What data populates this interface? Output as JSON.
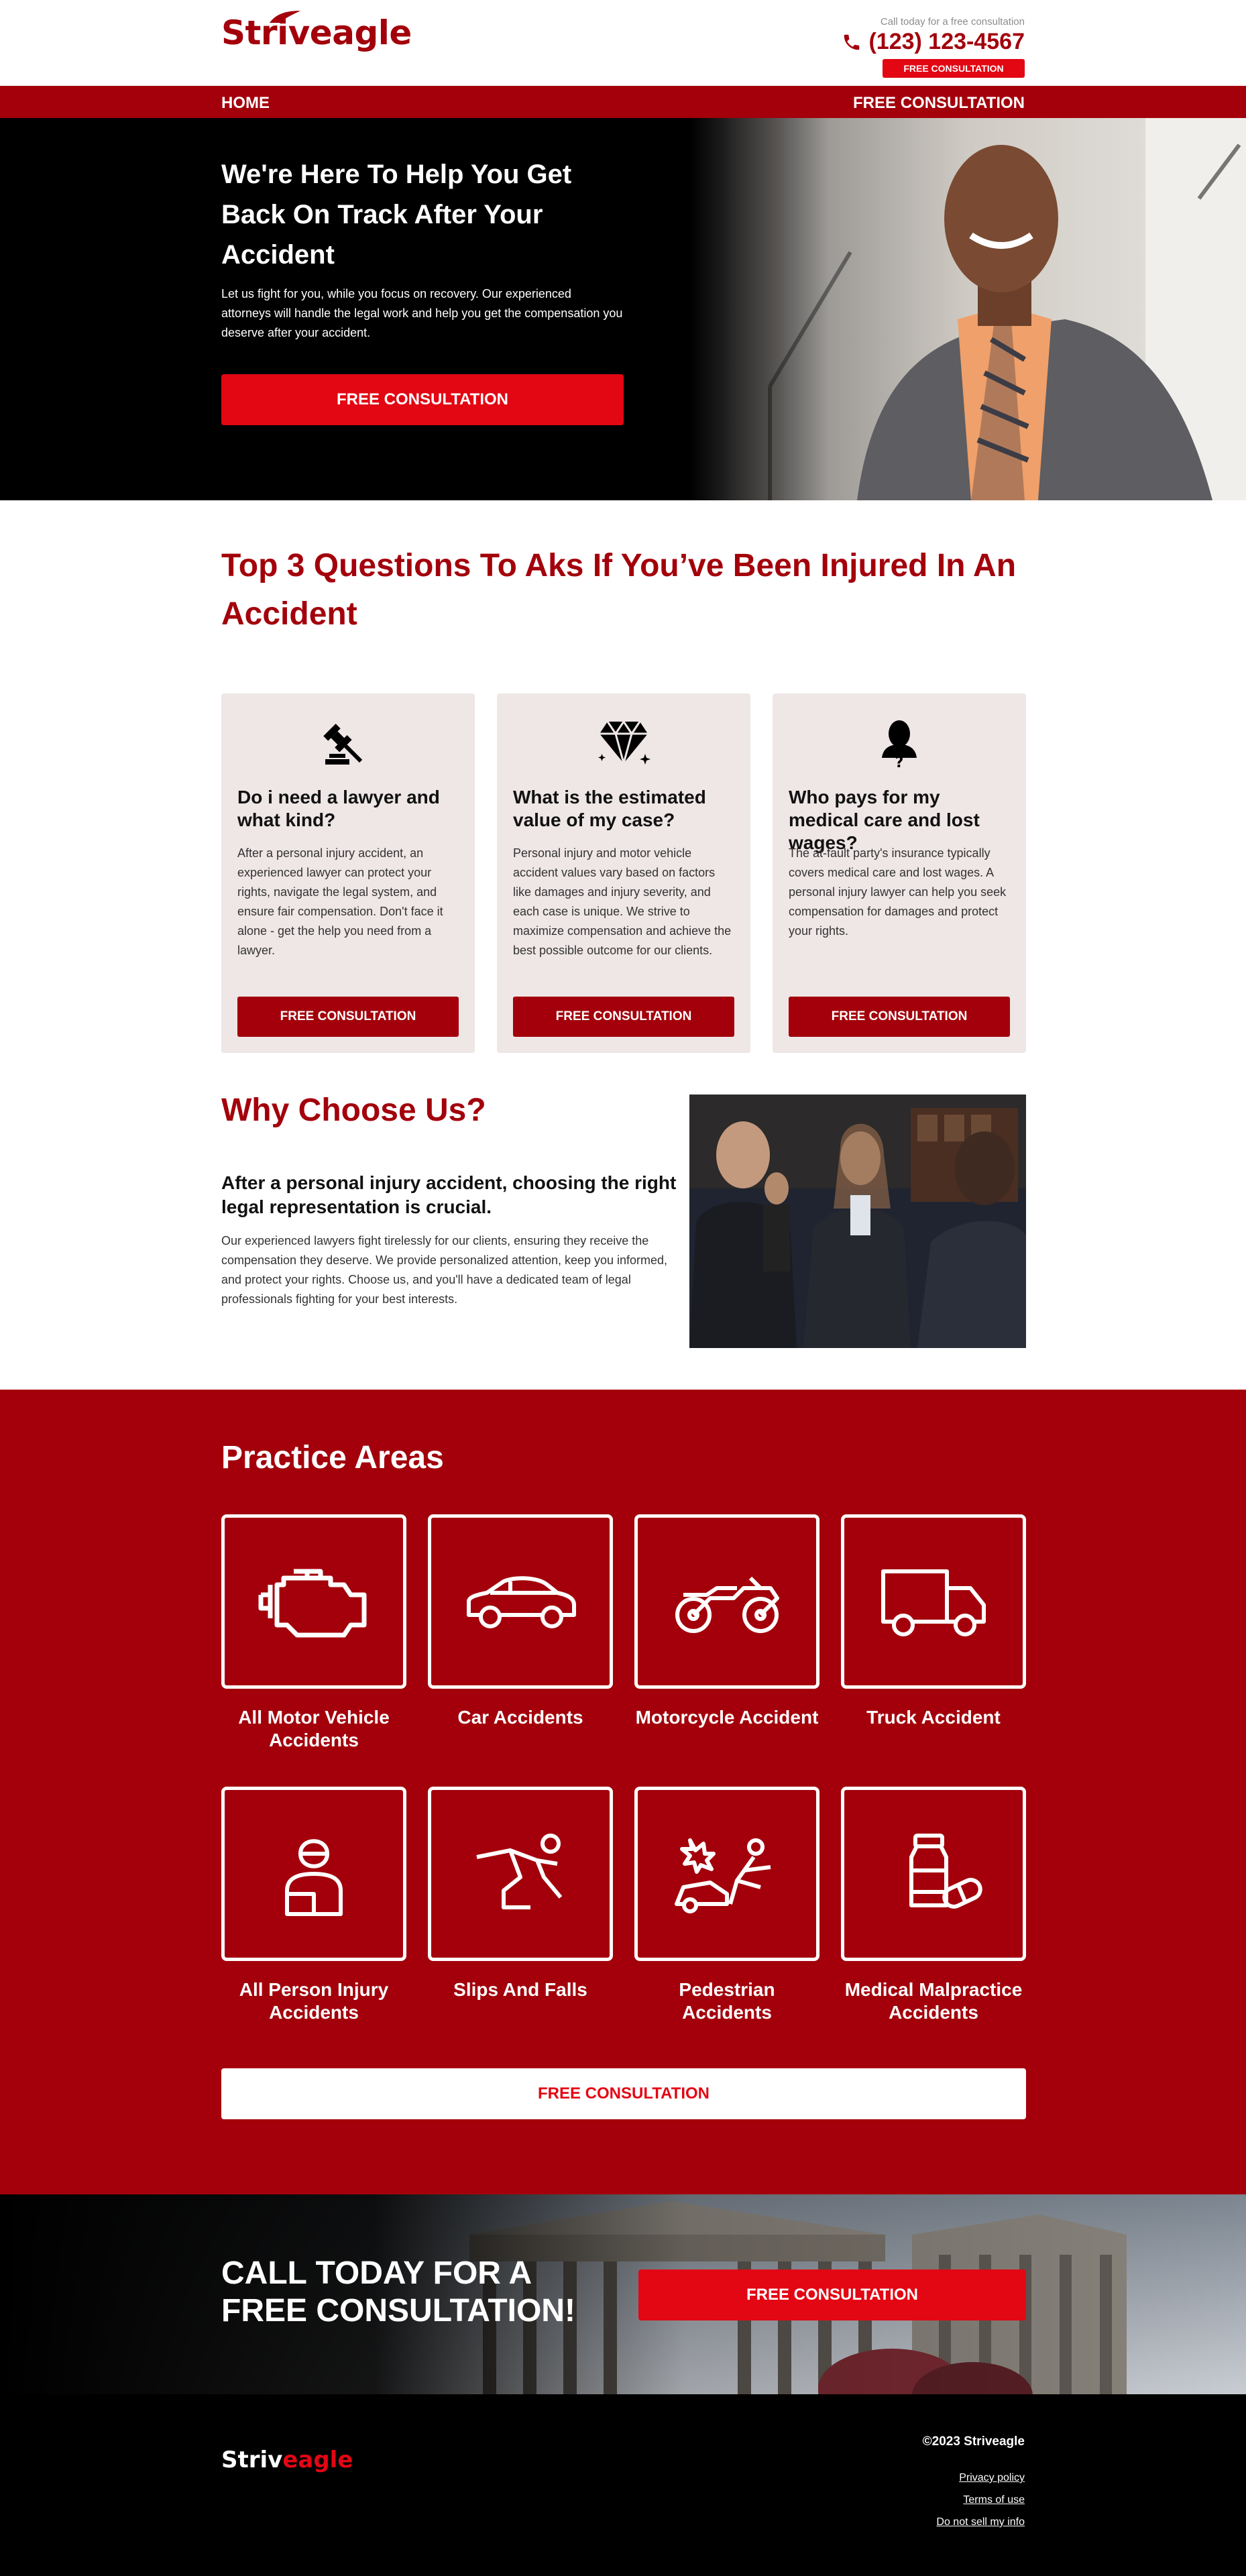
{
  "header": {
    "logo": "Striveagle",
    "consult_note": "Call today for a free consultation",
    "phone": "(123) 123-4567",
    "small_cta": "FREE CONSULTATION"
  },
  "nav": {
    "home": "HOME",
    "free_consultation": "FREE CONSULTATION"
  },
  "hero": {
    "title": "We're Here To Help You Get Back On Track After Your Accident",
    "text": "Let us fight for you, while you focus on recovery. Our experienced attorneys will handle the legal work and help you get the compensation you deserve after your accident.",
    "button": "FREE CONSULTATION"
  },
  "questions": {
    "title": "Top 3 Questions To Aks If You’ve Been Injured In An Accident",
    "cards": [
      {
        "icon": "gavel-icon",
        "heading": "Do i need a lawyer and what kind?",
        "text": "After a personal injury accident, an experienced lawyer can protect your rights, navigate the legal system, and ensure fair compensation. Don't face it alone - get the help you need from a lawyer.",
        "button": "FREE CONSULTATION"
      },
      {
        "icon": "diamond-icon",
        "heading": "What is the estimated value of my case?",
        "text": "Personal injury and motor vehicle accident values vary based on factors like damages and injury severity, and each case is unique. We strive to maximize compensation and achieve the best possible outcome for our clients.",
        "button": "FREE CONSULTATION"
      },
      {
        "icon": "person-question-icon",
        "heading": "Who pays for my medical care and lost wages?",
        "text": "The at-fault party's insurance typically covers medical care and lost wages. A personal injury lawyer can help you seek compensation for damages and protect your rights.",
        "button": "FREE CONSULTATION"
      }
    ]
  },
  "why": {
    "title": "Why Choose Us?",
    "subtitle": "After a personal injury accident, choosing the right legal representation is crucial.",
    "text": "Our experienced lawyers fight tirelessly for our clients, ensuring they receive the compensation they deserve. We provide personalized attention, keep you informed, and protect your rights. Choose us, and you'll have a dedicated team of legal professionals fighting for your best interests."
  },
  "practice": {
    "title": "Practice Areas",
    "areas": [
      {
        "label": "All Motor Vehicle Accidents",
        "icon": "engine-icon"
      },
      {
        "label": "Car Accidents",
        "icon": "car-icon"
      },
      {
        "label": "Motorcycle Accident",
        "icon": "motorcycle-icon"
      },
      {
        "label": "Truck Accident",
        "icon": "truck-icon"
      },
      {
        "label": "All Person Injury Accidents",
        "icon": "injured-person-icon"
      },
      {
        "label": "Slips And Falls",
        "icon": "slip-fall-icon"
      },
      {
        "label": "Pedestrian Accidents",
        "icon": "pedestrian-icon"
      },
      {
        "label": "Medical Malpractice Accidents",
        "icon": "medicine-icon"
      }
    ],
    "button": "FREE CONSULTATION"
  },
  "call": {
    "title": "CALL TODAY FOR A FREE CONSULTATION!",
    "button": "FREE CONSULTATION"
  },
  "footer": {
    "logo_main": "Striv",
    "logo_accent": "eagle",
    "copyright": "©2023 Striveagle",
    "links": [
      "Privacy policy",
      "Terms of use",
      "Do not sell my info"
    ]
  },
  "colors": {
    "brand_dark_red": "#a3000b",
    "brand_red": "#e30613",
    "card_bg": "#efe6e6"
  }
}
